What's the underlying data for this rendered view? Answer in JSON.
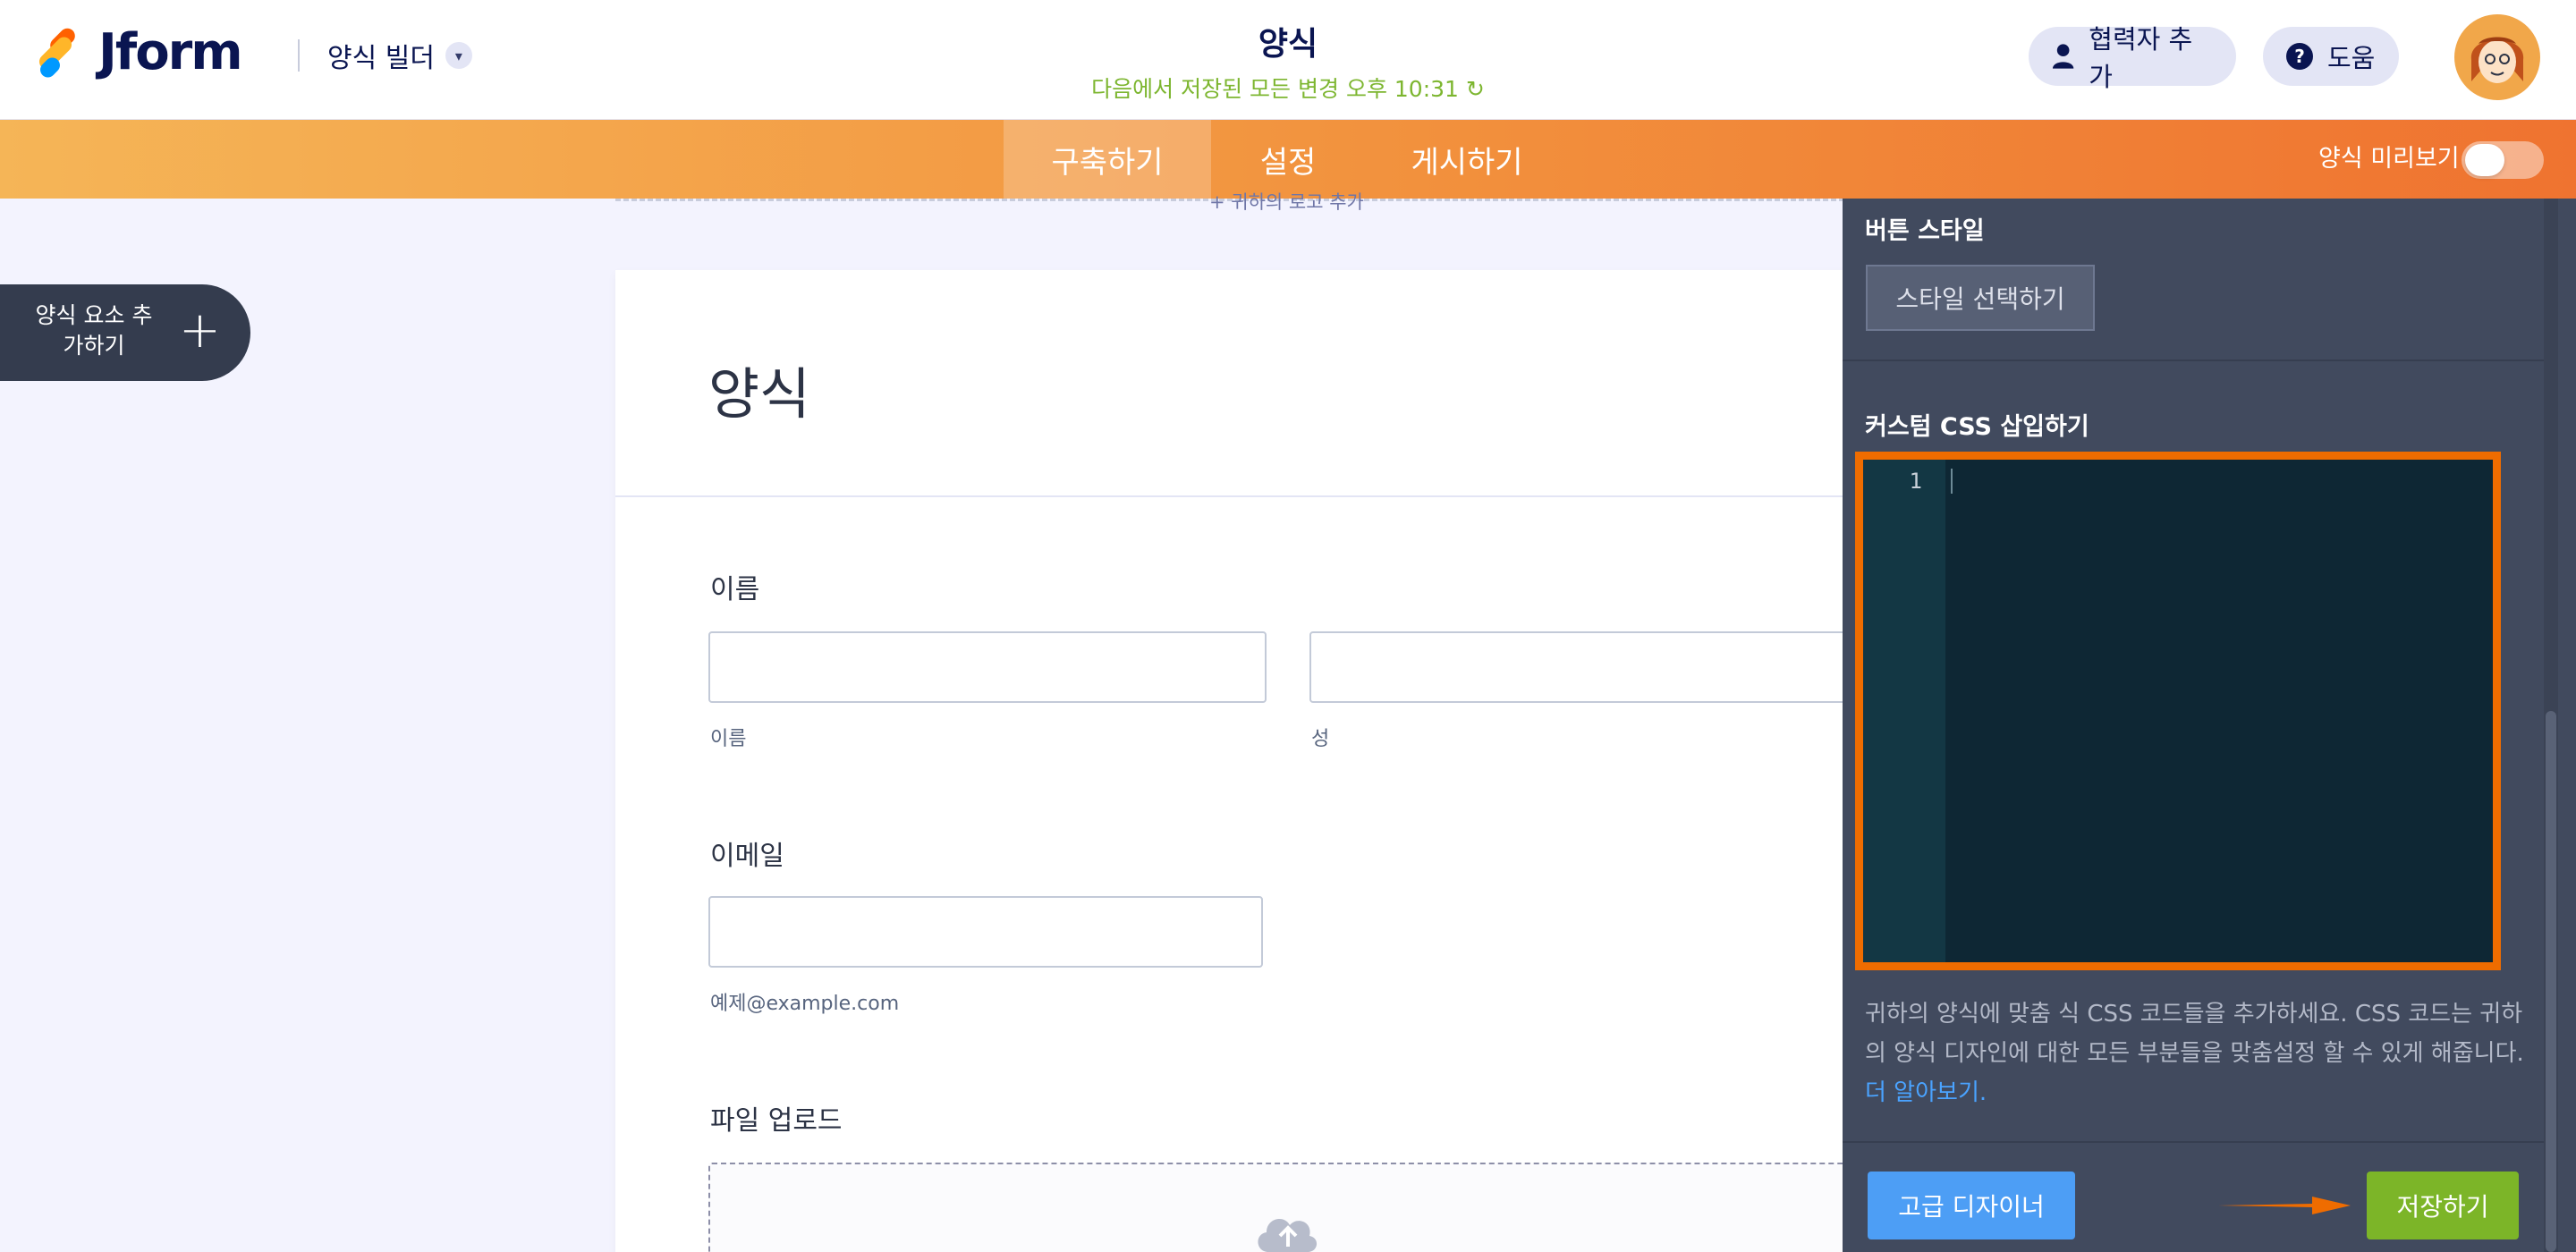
{
  "header": {
    "logo_text": "Jform",
    "builder_menu": "양식 빌더",
    "form_title": "양식",
    "save_status": "다음에서 저장된 모든 변경 오후 10:31",
    "collaborator_button": "협력자 추가",
    "help_button": "도움"
  },
  "nav": {
    "tabs": [
      {
        "label": "구축하기",
        "active": true
      },
      {
        "label": "설정",
        "active": false
      },
      {
        "label": "게시하기",
        "active": false
      }
    ],
    "preview_label": "양식 미리보기",
    "preview_enabled": false
  },
  "sidebar": {
    "add_element_label": "양식 요소 추가하기"
  },
  "form": {
    "logo_hint": "+ 귀하의 로고 추가",
    "heading": "양식",
    "fields": {
      "name_label": "이름",
      "first_sub": "이름",
      "last_sub": "성",
      "email_label": "이메일",
      "email_sub": "예제@example.com",
      "upload_label": "파일 업로드"
    }
  },
  "panel": {
    "button_style_heading": "버튼 스타일",
    "style_button": "스타일 선택하기",
    "custom_css_heading": "커스텀 CSS 삽입하기",
    "editor_line": "1",
    "description": "귀하의 양식에 맞춤 식 CSS 코드들을 추가하세요. CSS 코드는 귀하의 양식 디자인에 대한 모든 부분들을 맞춤설정 할 수 있게 해줍니다.",
    "learn_more": "더 알아보기.",
    "advanced_designer_button": "고급 디자이너",
    "save_button": "저장하기"
  },
  "colors": {
    "accent_orange": "#ef6c00",
    "save_green": "#7cb528",
    "link_blue": "#4aa3ff",
    "status_green": "#7db630"
  }
}
